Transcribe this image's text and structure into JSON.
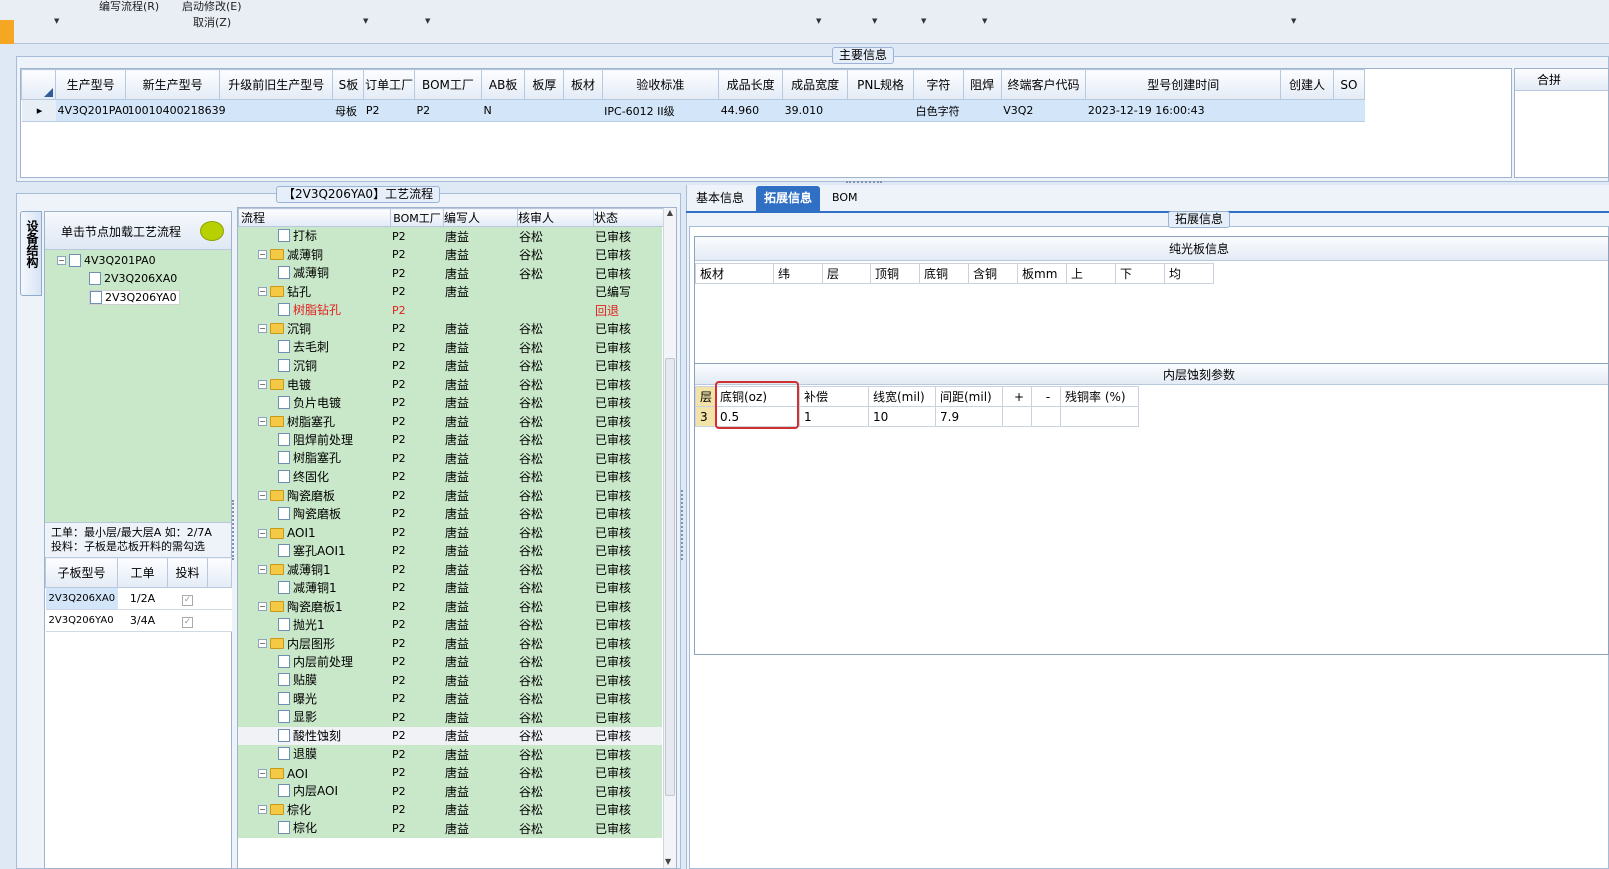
{
  "menu": {
    "items": [
      "编写流程(R)",
      "启动修改(E)",
      "取消(Z)"
    ]
  },
  "main_section": {
    "title": "主要信息",
    "columns": [
      "生产型号",
      "新生产型号",
      "升级前旧生产型号",
      "S板",
      "订单工厂",
      "BOM工厂",
      "AB板",
      "板厚",
      "板材",
      "验收标准",
      "成品长度",
      "成品宽度",
      "PNL规格",
      "字符",
      "阻焊",
      "终端客户代码",
      "型号创建时间",
      "创建人",
      "SO"
    ],
    "row": [
      "4V3Q201PA0",
      "10010400218639",
      "",
      "母板",
      "P2",
      "P2",
      "N",
      "",
      "",
      "IPC-6012 II级",
      "44.960",
      "39.010",
      "",
      "白色字符",
      "",
      "V3Q2",
      "2023-12-19 16:00:43",
      "",
      ""
    ],
    "right_label": "合拼"
  },
  "left_panel": {
    "vertical_tab": "设备结构",
    "hint": "单击节点加载工艺流程",
    "tree": [
      "4V3Q201PA0",
      "2V3Q206XA0",
      "2V3Q206YA0"
    ],
    "note_line1": "工单：最小层/最大层A 如：2/7A",
    "note_line2": "投料：子板是芯板开料的需勾选",
    "sub_columns": [
      "子板型号",
      "工单",
      "投料"
    ],
    "sub_rows": [
      {
        "model": "2V3Q206XA0",
        "order": "1/2A"
      },
      {
        "model": "2V3Q206YA0",
        "order": "3/4A"
      }
    ]
  },
  "flow": {
    "title": "【2V3Q206YA0】工艺流程",
    "columns": [
      "流程",
      "BOM工厂",
      "编写人",
      "核审人",
      "状态"
    ],
    "rows": [
      {
        "name": "打标",
        "child": true,
        "bom": "P2",
        "writer": "唐益",
        "reviewer": "谷松",
        "status": "已审核"
      },
      {
        "name": "减薄铜",
        "child": false,
        "bom": "P2",
        "writer": "唐益",
        "reviewer": "谷松",
        "status": "已审核"
      },
      {
        "name": "减薄铜",
        "child": true,
        "bom": "P2",
        "writer": "唐益",
        "reviewer": "谷松",
        "status": "已审核"
      },
      {
        "name": "钻孔",
        "child": false,
        "bom": "P2",
        "writer": "唐益",
        "reviewer": "",
        "status": "已编写"
      },
      {
        "name": "树脂钻孔",
        "child": true,
        "red": true,
        "bom": "P2",
        "writer": "",
        "reviewer": "",
        "status": "回退"
      },
      {
        "name": "沉铜",
        "child": false,
        "bom": "P2",
        "writer": "唐益",
        "reviewer": "谷松",
        "status": "已审核"
      },
      {
        "name": "去毛刺",
        "child": true,
        "bom": "P2",
        "writer": "唐益",
        "reviewer": "谷松",
        "status": "已审核"
      },
      {
        "name": "沉铜",
        "child": true,
        "bom": "P2",
        "writer": "唐益",
        "reviewer": "谷松",
        "status": "已审核"
      },
      {
        "name": "电镀",
        "child": false,
        "bom": "P2",
        "writer": "唐益",
        "reviewer": "谷松",
        "status": "已审核"
      },
      {
        "name": "负片电镀",
        "child": true,
        "bom": "P2",
        "writer": "唐益",
        "reviewer": "谷松",
        "status": "已审核"
      },
      {
        "name": "树脂塞孔",
        "child": false,
        "bom": "P2",
        "writer": "唐益",
        "reviewer": "谷松",
        "status": "已审核"
      },
      {
        "name": "阻焊前处理",
        "child": true,
        "bom": "P2",
        "writer": "唐益",
        "reviewer": "谷松",
        "status": "已审核"
      },
      {
        "name": "树脂塞孔",
        "child": true,
        "bom": "P2",
        "writer": "唐益",
        "reviewer": "谷松",
        "status": "已审核"
      },
      {
        "name": "终固化",
        "child": true,
        "bom": "P2",
        "writer": "唐益",
        "reviewer": "谷松",
        "status": "已审核"
      },
      {
        "name": "陶瓷磨板",
        "child": false,
        "bom": "P2",
        "writer": "唐益",
        "reviewer": "谷松",
        "status": "已审核"
      },
      {
        "name": "陶瓷磨板",
        "child": true,
        "bom": "P2",
        "writer": "唐益",
        "reviewer": "谷松",
        "status": "已审核"
      },
      {
        "name": "AOI1",
        "child": false,
        "bom": "P2",
        "writer": "唐益",
        "reviewer": "谷松",
        "status": "已审核"
      },
      {
        "name": "塞孔AOI1",
        "child": true,
        "bom": "P2",
        "writer": "唐益",
        "reviewer": "谷松",
        "status": "已审核"
      },
      {
        "name": "减薄铜1",
        "child": false,
        "bom": "P2",
        "writer": "唐益",
        "reviewer": "谷松",
        "status": "已审核"
      },
      {
        "name": "减薄铜1",
        "child": true,
        "bom": "P2",
        "writer": "唐益",
        "reviewer": "谷松",
        "status": "已审核"
      },
      {
        "name": "陶瓷磨板1",
        "child": false,
        "bom": "P2",
        "writer": "唐益",
        "reviewer": "谷松",
        "status": "已审核"
      },
      {
        "name": "抛光1",
        "child": true,
        "bom": "P2",
        "writer": "唐益",
        "reviewer": "谷松",
        "status": "已审核"
      },
      {
        "name": "内层图形",
        "child": false,
        "bom": "P2",
        "writer": "唐益",
        "reviewer": "谷松",
        "status": "已审核"
      },
      {
        "name": "内层前处理",
        "child": true,
        "bom": "P2",
        "writer": "唐益",
        "reviewer": "谷松",
        "status": "已审核"
      },
      {
        "name": "贴膜",
        "child": true,
        "bom": "P2",
        "writer": "唐益",
        "reviewer": "谷松",
        "status": "已审核"
      },
      {
        "name": "曝光",
        "child": true,
        "bom": "P2",
        "writer": "唐益",
        "reviewer": "谷松",
        "status": "已审核"
      },
      {
        "name": "显影",
        "child": true,
        "bom": "P2",
        "writer": "唐益",
        "reviewer": "谷松",
        "status": "已审核"
      },
      {
        "name": "酸性蚀刻",
        "child": true,
        "sel": true,
        "bom": "P2",
        "writer": "唐益",
        "reviewer": "谷松",
        "status": "已审核"
      },
      {
        "name": "退膜",
        "child": true,
        "bom": "P2",
        "writer": "唐益",
        "reviewer": "谷松",
        "status": "已审核"
      },
      {
        "name": "AOI",
        "child": false,
        "bom": "P2",
        "writer": "唐益",
        "reviewer": "谷松",
        "status": "已审核"
      },
      {
        "name": "内层AOI",
        "child": true,
        "bom": "P2",
        "writer": "唐益",
        "reviewer": "谷松",
        "status": "已审核"
      },
      {
        "name": "棕化",
        "child": false,
        "bom": "P2",
        "writer": "唐益",
        "reviewer": "谷松",
        "status": "已审核"
      },
      {
        "name": "棕化",
        "child": true,
        "bom": "P2",
        "writer": "唐益",
        "reviewer": "谷松",
        "status": "已审核"
      }
    ]
  },
  "tabs": [
    "基本信息",
    "拓展信息",
    "BOM"
  ],
  "ext": {
    "title": "拓展信息",
    "plain_title": "纯光板信息",
    "plain_columns": [
      "板材",
      "纬",
      "层",
      "顶铜",
      "底铜",
      "含铜",
      "板mm",
      "上",
      "下",
      "均"
    ],
    "etch_title": "内层蚀刻参数",
    "etch_columns": [
      "层",
      "底铜(oz)",
      "补偿",
      "线宽(mil)",
      "间距(mil)",
      "+",
      "-",
      "残铜率 (%)"
    ],
    "etch_row": [
      "3",
      "0.5",
      "1",
      "10",
      "7.9",
      "",
      "",
      ""
    ]
  },
  "colors": {
    "highlight_box": "#d03030",
    "flow_row": "#c9e7c9",
    "selected_row": "#d3e5f8",
    "active_tab": "#2f6fc4"
  }
}
